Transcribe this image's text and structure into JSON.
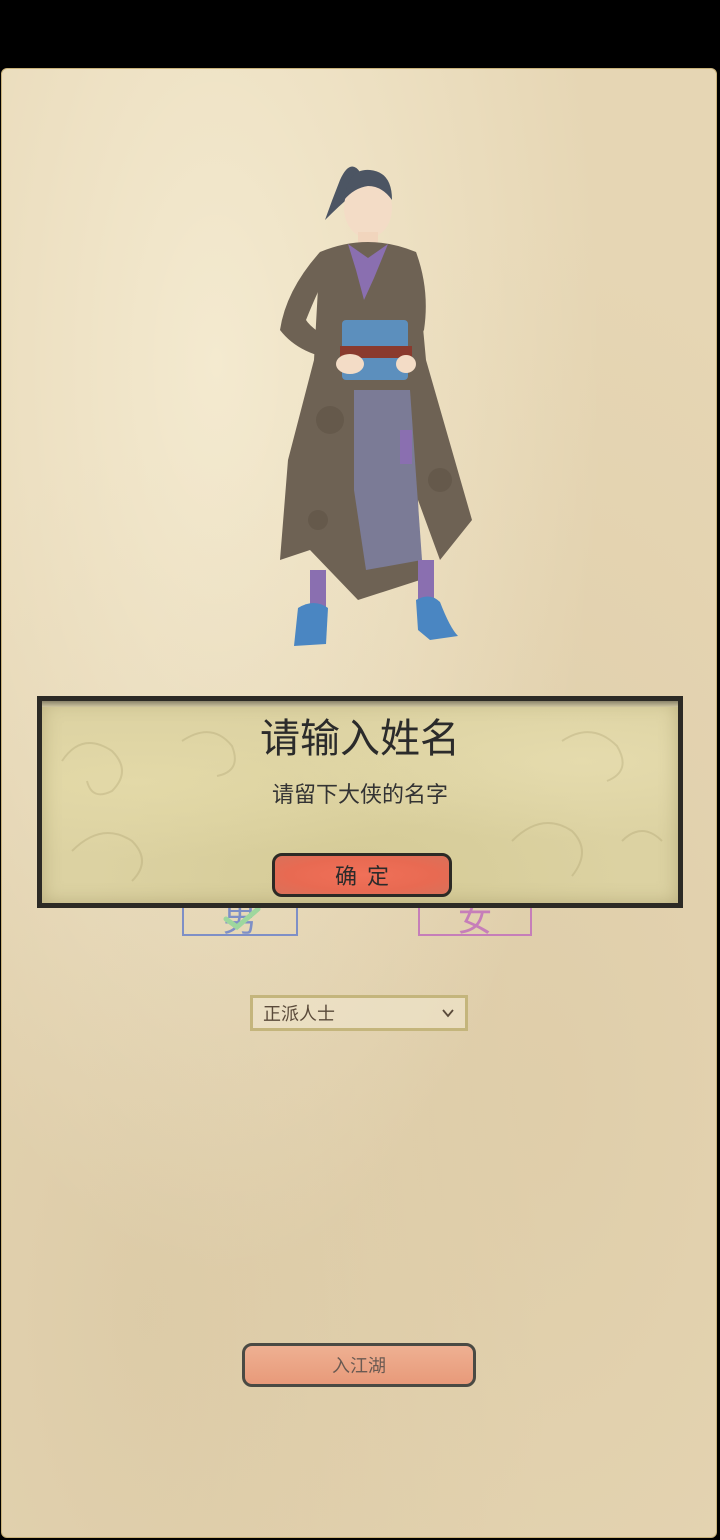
{
  "dialog": {
    "title": "请输入姓名",
    "message": "请留下大侠的名字",
    "confirm_label": "确定"
  },
  "gender": {
    "male_label": "男",
    "female_label": "女",
    "selected": "male"
  },
  "faction": {
    "selected": "正派人士"
  },
  "enter_button_label": "入江湖",
  "colors": {
    "parchment": "#e6d6b4",
    "confirm_button": "#e86a52",
    "enter_button": "#e89a7a",
    "male_border": "#7e8fc6",
    "female_border": "#c67eb9"
  },
  "icons": {
    "select_arrow": "chevron-down-icon",
    "selected_mark": "check-icon"
  }
}
